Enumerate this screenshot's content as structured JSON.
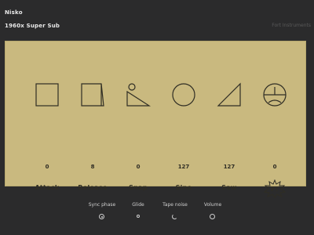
{
  "header": {
    "title": "Nisko",
    "subtitle": "1960x Super Sub",
    "brand": "Fort Instruments"
  },
  "params": [
    {
      "label": "Attack",
      "value": "0",
      "icon": "square-icon"
    },
    {
      "label": "Release",
      "value": "8",
      "icon": "skewed-square-icon"
    },
    {
      "label": "Snap",
      "value": "0",
      "icon": "ball-on-slope-icon"
    },
    {
      "label": "Sine",
      "value": "127",
      "icon": "circle-icon"
    },
    {
      "label": "Saw",
      "value": "127",
      "icon": "triangle-icon"
    },
    {
      "label": "F!",
      "value": "0",
      "icon": "gauge-icon"
    }
  ],
  "toggles": [
    {
      "label": "Sync phase",
      "state": "on"
    },
    {
      "label": "Glide",
      "state": "small"
    },
    {
      "label": "Tape noise",
      "state": "partial"
    },
    {
      "label": "Volume",
      "state": "off"
    }
  ],
  "colors": {
    "background": "#2b2b2c",
    "panel": "#c9b97f",
    "ink": "#2f2d24"
  }
}
